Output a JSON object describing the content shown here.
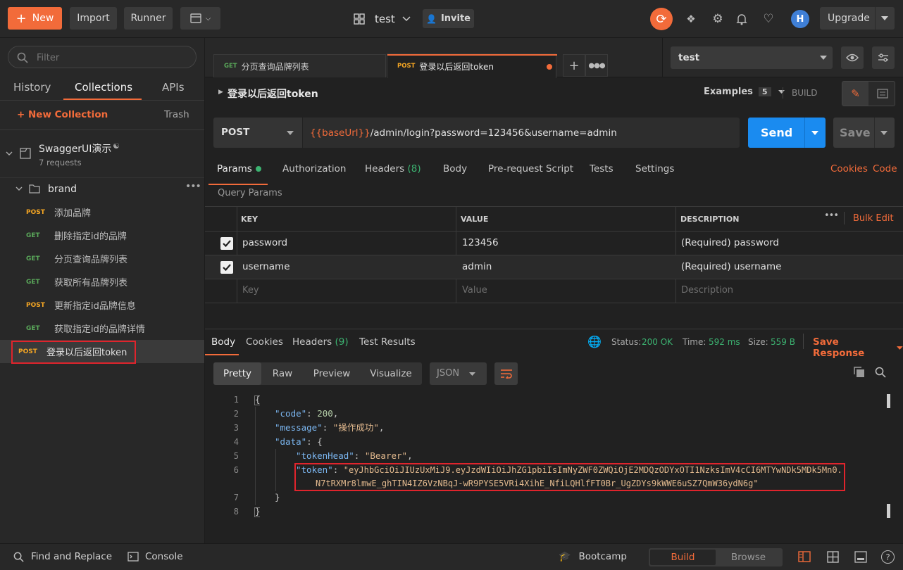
{
  "topbar": {
    "new_label": "New",
    "import_label": "Import",
    "runner_label": "Runner",
    "workspace_name": "test",
    "invite_label": "Invite",
    "upgrade_label": "Upgrade"
  },
  "sidebar": {
    "search_placeholder": "Filter",
    "tabs": [
      "History",
      "Collections",
      "APIs"
    ],
    "new_collection_label": "+ New Collection",
    "trash_label": "Trash",
    "collection": {
      "name": "SwaggerUI演示",
      "count": "7 requests"
    },
    "folder": "brand",
    "requests": [
      {
        "method": "POST",
        "name": "添加品牌"
      },
      {
        "method": "GET",
        "name": "删除指定id的品牌"
      },
      {
        "method": "GET",
        "name": "分页查询品牌列表"
      },
      {
        "method": "GET",
        "name": "获取所有品牌列表"
      },
      {
        "method": "POST",
        "name": "更新指定id品牌信息"
      },
      {
        "method": "GET",
        "name": "获取指定id的品牌详情"
      },
      {
        "method": "POST",
        "name": "登录以后返回token"
      }
    ]
  },
  "tabs": [
    {
      "method": "GET",
      "name": "分页查询品牌列表"
    },
    {
      "method": "POST",
      "name": "登录以后返回token"
    }
  ],
  "environment": "test",
  "request": {
    "title": "登录以后返回token",
    "examples_label": "Examples",
    "examples_count": "5",
    "build_label": "BUILD",
    "method": "POST",
    "url_var": "{{baseUrl}}",
    "url_rest": "/admin/login?password=123456&username=admin",
    "send_label": "Send",
    "save_label": "Save"
  },
  "request_tabs": {
    "params": "Params",
    "authorization": "Authorization",
    "headers": "Headers",
    "headers_count": "(8)",
    "body": "Body",
    "prerequest": "Pre-request Script",
    "tests": "Tests",
    "settings": "Settings",
    "cookies": "Cookies",
    "code": "Code"
  },
  "params": {
    "section_title": "Query Params",
    "headers": [
      "KEY",
      "VALUE",
      "DESCRIPTION"
    ],
    "bulk_edit": "Bulk Edit",
    "rows": [
      {
        "key": "password",
        "value": "123456",
        "description": "(Required) password"
      },
      {
        "key": "username",
        "value": "admin",
        "description": "(Required) username"
      }
    ],
    "placeholder": {
      "key": "Key",
      "value": "Value",
      "description": "Description"
    }
  },
  "response": {
    "tabs": {
      "body": "Body",
      "cookies": "Cookies",
      "headers": "Headers",
      "headers_count": "(9)",
      "tests": "Test Results"
    },
    "status_label": "Status:",
    "status_value": "200 OK",
    "time_label": "Time:",
    "time_value": "592 ms",
    "size_label": "Size:",
    "size_value": "559 B",
    "save_response": "Save Response",
    "view_modes": [
      "Pretty",
      "Raw",
      "Preview",
      "Visualize"
    ],
    "format": "JSON",
    "line_numbers": [
      "1",
      "2",
      "3",
      "4",
      "5",
      "6",
      "",
      "7",
      "8"
    ],
    "code": {
      "l1": "{",
      "code_key": "\"code\"",
      "code_val": "200",
      "message_key": "\"message\"",
      "message_val": "\"操作成功\"",
      "data_key": "\"data\"",
      "tokenhead_key": "\"tokenHead\"",
      "tokenhead_val": "\"Bearer\"",
      "token_key": "\"token\"",
      "token_val_1": "\"eyJhbGciOiJIUzUxMiJ9.eyJzdWIiOiJhZG1pbiIsImNyZWF0ZWQiOjE2MDQzODYxOTI1NzksImV4cCI6MTYwNDk5MDk5Mn0.",
      "token_val_2": "N7tRXMr8lmwE_ghTIN4IZ6VzNBqJ-wR9PYSE5VRi4XihE_NfiLQHlfFT0Br_UgZDYs9kWWE6uSZ7QmW36ydN6g\"",
      "close_inner": "}",
      "close_outer": "}"
    }
  },
  "bottombar": {
    "find_replace": "Find and Replace",
    "console": "Console",
    "bootcamp": "Bootcamp",
    "build": "Build",
    "browse": "Browse"
  }
}
